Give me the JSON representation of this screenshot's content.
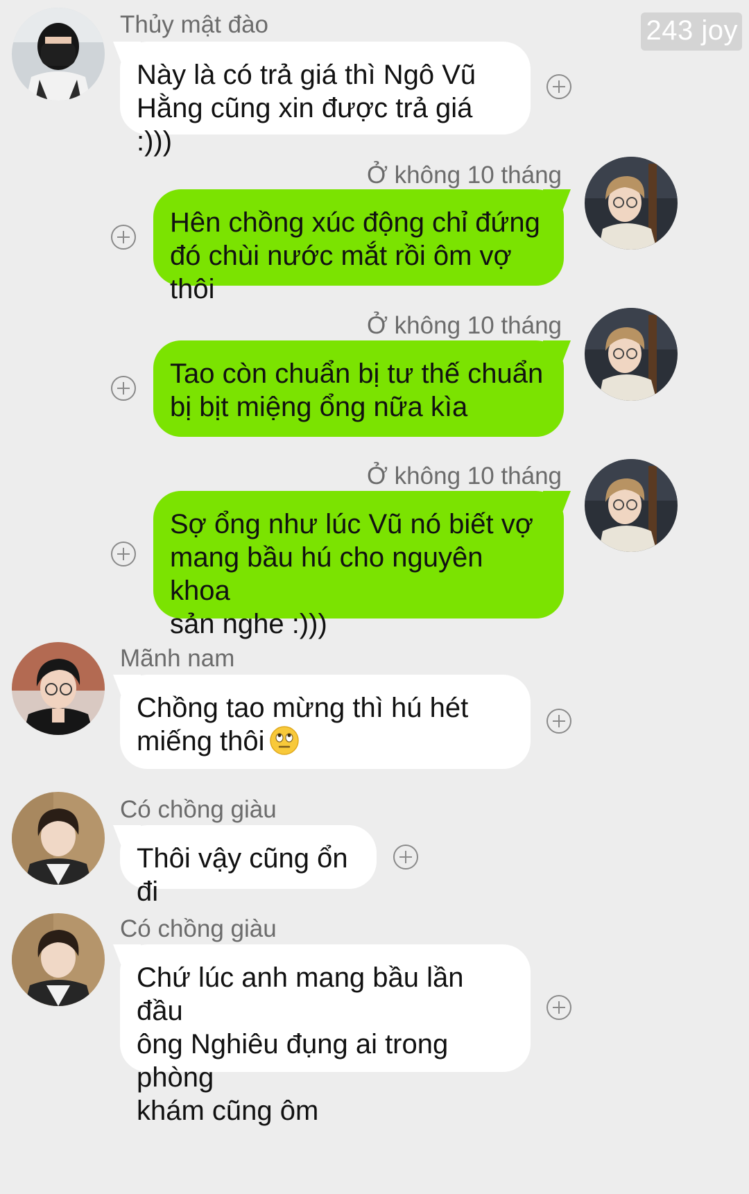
{
  "watermark": "243 joy",
  "messages": [
    {
      "sender": "Thủy mật đào",
      "text_lines": [
        "Này là có trả giá thì Ngô Vũ",
        "Hằng cũng xin được trả giá :)))"
      ],
      "direction": "incoming",
      "avatar": "masked-person-avatar"
    },
    {
      "sender": "Ở không 10 tháng",
      "text_lines": [
        "Hên chồng xúc động chỉ đứng",
        "đó chùi nước mắt rồi ôm vợ thôi"
      ],
      "direction": "outgoing",
      "avatar": "musician-avatar"
    },
    {
      "sender": "Ở không 10 tháng",
      "text_lines": [
        "Tao còn chuẩn bị tư thế chuẩn",
        "bị bịt miệng ổng nữa kìa"
      ],
      "direction": "outgoing",
      "avatar": "musician-avatar"
    },
    {
      "sender": "Ở không 10 tháng",
      "text_lines": [
        "Sợ ổng như lúc Vũ nó biết vợ",
        "mang bầu hú cho nguyên khoa",
        "sản nghe :)))"
      ],
      "direction": "outgoing",
      "avatar": "musician-avatar"
    },
    {
      "sender": "Mãnh nam",
      "text_lines": [
        "Chồng tao mừng thì hú hét",
        "miếng thôi"
      ],
      "emoji": "eye-roll-emoji",
      "direction": "incoming",
      "avatar": "young-man-avatar"
    },
    {
      "sender": "Có chồng giàu",
      "text_lines": [
        "Thôi vậy cũng ổn đi"
      ],
      "direction": "incoming",
      "avatar": "boy-avatar"
    },
    {
      "sender": "Có chồng giàu",
      "text_lines": [
        "Chứ lúc anh mang bầu lần đầu",
        "ông Nghiêu đụng ai trong phòng",
        "khám cũng ôm"
      ],
      "direction": "incoming",
      "avatar": "boy-avatar"
    }
  ],
  "colors": {
    "background": "#ededed",
    "incoming_bubble": "#ffffff",
    "outgoing_bubble": "#7be301",
    "sender_name": "#6b6b6b"
  },
  "icons": {
    "add_reaction": "plus-circle-icon"
  }
}
